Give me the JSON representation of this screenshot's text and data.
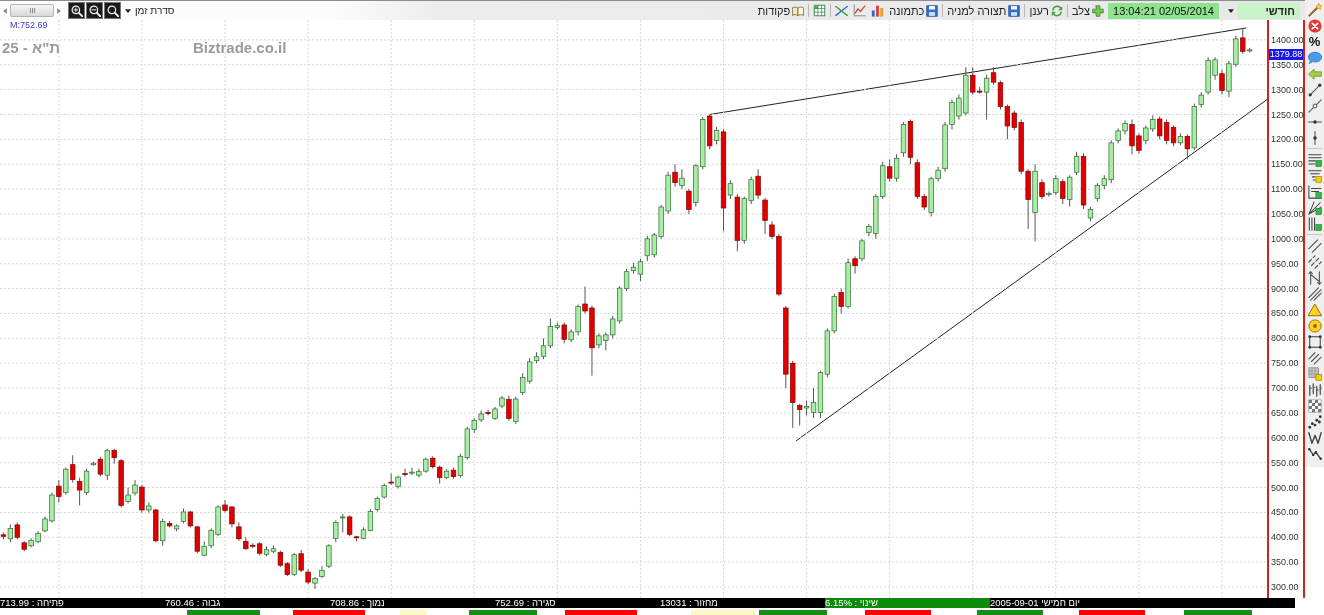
{
  "toolbar": {
    "period_dropdown": {
      "value": "חודשי"
    },
    "datetime": "13:04:21 02/05/2014",
    "buttons": [
      {
        "label": "צלב"
      },
      {
        "label": "רענן"
      },
      {
        "label": "תצורה למניה"
      },
      {
        "label": "כתמונה"
      },
      {
        "label": "פקודות"
      }
    ],
    "time_series_dropdown": {
      "label": "סדרת זמן"
    }
  },
  "drawing_tools": {
    "percent_label": "%"
  },
  "chart": {
    "marker_reading": "M:752.69",
    "instrument_label": "ת\"א - 25",
    "brand_label": "Biztrade.co.il",
    "last_price": "1379.88",
    "chart_data": {
      "type": "candlestick",
      "categories": [
        null,
        null,
        null,
        null,
        null,
        null,
        null,
        null,
        null,
        null,
        null,
        null,
        null,
        null,
        null,
        null,
        null,
        null,
        null,
        null,
        null,
        null,
        null,
        null,
        null,
        null,
        null,
        null,
        null,
        null,
        null,
        null,
        null,
        null,
        null,
        null,
        null,
        null,
        null,
        null,
        null,
        null,
        null,
        null,
        null,
        null,
        null,
        null,
        null,
        null,
        null,
        null,
        null,
        null,
        null,
        null,
        null,
        null,
        null,
        null,
        null,
        null,
        null,
        null,
        null,
        null,
        null,
        null,
        null,
        null,
        null,
        null,
        null,
        null,
        null,
        null,
        null,
        null,
        null,
        null,
        null,
        null,
        null,
        null,
        null,
        null,
        null,
        null,
        null,
        null,
        null,
        null,
        null,
        null,
        null,
        null,
        null,
        null,
        null,
        null,
        null,
        null,
        null,
        null,
        null,
        null,
        null,
        null,
        null,
        null,
        null,
        null,
        null,
        null,
        null,
        null,
        null,
        null,
        null,
        null,
        null,
        null,
        null,
        null,
        null,
        null,
        null,
        null,
        null,
        null,
        null,
        null,
        null,
        null,
        null,
        null,
        null,
        null,
        null,
        null,
        null,
        null,
        null,
        null,
        null,
        null,
        null,
        null,
        null,
        null,
        null,
        null,
        null,
        null,
        null,
        null,
        null,
        null,
        null,
        null,
        null,
        null,
        null,
        null,
        null,
        null,
        null,
        null,
        null,
        null,
        null,
        null,
        null,
        null,
        null,
        null,
        null,
        null,
        null,
        null,
        null,
        null,
        null
      ],
      "ohlc": [
        [
          405,
          410,
          396,
          402
        ],
        [
          397,
          426,
          390,
          418
        ],
        [
          425,
          430,
          396,
          400
        ],
        [
          389,
          392,
          372,
          376
        ],
        [
          383,
          398,
          380,
          394
        ],
        [
          391,
          412,
          388,
          408
        ],
        [
          413,
          442,
          410,
          437
        ],
        [
          433,
          490,
          430,
          485
        ],
        [
          503,
          515,
          470,
          482
        ],
        [
          490,
          540,
          486,
          537
        ],
        [
          546,
          565,
          510,
          516
        ],
        [
          512,
          520,
          464,
          495
        ],
        [
          490,
          538,
          485,
          533
        ],
        [
          546,
          552,
          544,
          549
        ],
        [
          557,
          562,
          522,
          527
        ],
        [
          525,
          578,
          515,
          575
        ],
        [
          575,
          578,
          548,
          560
        ],
        [
          554,
          557,
          460,
          464
        ],
        [
          472,
          500,
          468,
          485
        ],
        [
          489,
          515,
          484,
          505
        ],
        [
          501,
          505,
          450,
          455
        ],
        [
          455,
          470,
          450,
          463
        ],
        [
          455,
          457,
          390,
          393
        ],
        [
          393,
          437,
          383,
          432
        ],
        [
          428,
          433,
          420,
          423
        ],
        [
          417,
          426,
          412,
          423
        ],
        [
          432,
          458,
          428,
          451
        ],
        [
          451,
          453,
          420,
          423
        ],
        [
          421,
          423,
          368,
          372
        ],
        [
          364,
          392,
          362,
          382
        ],
        [
          383,
          418,
          378,
          414
        ],
        [
          406,
          464,
          402,
          461
        ],
        [
          465,
          475,
          450,
          454
        ],
        [
          461,
          463,
          420,
          427
        ],
        [
          421,
          430,
          393,
          397
        ],
        [
          392,
          400,
          375,
          377
        ],
        [
          384,
          388,
          378,
          382
        ],
        [
          387,
          390,
          364,
          368
        ],
        [
          366,
          382,
          362,
          375
        ],
        [
          372,
          384,
          368,
          377
        ],
        [
          370,
          373,
          340,
          344
        ],
        [
          347,
          350,
          322,
          325
        ],
        [
          325,
          368,
          322,
          365
        ],
        [
          367,
          375,
          330,
          334
        ],
        [
          330,
          336,
          306,
          310
        ],
        [
          308,
          320,
          296,
          317
        ],
        [
          321,
          342,
          318,
          333
        ],
        [
          342,
          386,
          338,
          383
        ],
        [
          398,
          434,
          390,
          430
        ],
        [
          439,
          447,
          410,
          441
        ],
        [
          441,
          444,
          402,
          406
        ],
        [
          401,
          403,
          392,
          399
        ],
        [
          398,
          420,
          396,
          415
        ],
        [
          414,
          457,
          412,
          452
        ],
        [
          456,
          482,
          452,
          478
        ],
        [
          481,
          508,
          478,
          504
        ],
        [
          511,
          528,
          506,
          509
        ],
        [
          502,
          524,
          498,
          521
        ],
        [
          528,
          538,
          522,
          526
        ],
        [
          529,
          540,
          525,
          531
        ],
        [
          525,
          538,
          520,
          532
        ],
        [
          533,
          560,
          530,
          557
        ],
        [
          559,
          563,
          538,
          542
        ],
        [
          541,
          544,
          508,
          520
        ],
        [
          520,
          537,
          517,
          533
        ],
        [
          535,
          540,
          518,
          522
        ],
        [
          524,
          568,
          520,
          563
        ],
        [
          560,
          622,
          556,
          618
        ],
        [
          617,
          640,
          610,
          635
        ],
        [
          636,
          655,
          632,
          648
        ],
        [
          651,
          656,
          645,
          649
        ],
        [
          639,
          662,
          636,
          658
        ],
        [
          664,
          684,
          660,
          680
        ],
        [
          677,
          685,
          634,
          639
        ],
        [
          633,
          683,
          628,
          678
        ],
        [
          691,
          730,
          686,
          721
        ],
        [
          713.99,
          760.46,
          708.86,
          752.69
        ],
        [
          755,
          772,
          750,
          763
        ],
        [
          764,
          800,
          758,
          785
        ],
        [
          785,
          840,
          780,
          824
        ],
        [
          822,
          832,
          818,
          826
        ],
        [
          827,
          832,
          790,
          798
        ],
        [
          797,
          818,
          792,
          813
        ],
        [
          813,
          868,
          806,
          864
        ],
        [
          869,
          904,
          850,
          855
        ],
        [
          861,
          866,
          725,
          781
        ],
        [
          787,
          810,
          780,
          805
        ],
        [
          796,
          812,
          776,
          807
        ],
        [
          807,
          845,
          800,
          839
        ],
        [
          835,
          905,
          830,
          901
        ],
        [
          900,
          940,
          895,
          934
        ],
        [
          936,
          952,
          930,
          943
        ],
        [
          929,
          960,
          915,
          954
        ],
        [
          966,
          1006,
          955,
          1000
        ],
        [
          968,
          1012,
          962,
          1008
        ],
        [
          1005,
          1068,
          1000,
          1064
        ],
        [
          1056,
          1135,
          1050,
          1128
        ],
        [
          1134,
          1150,
          1105,
          1113
        ],
        [
          1107,
          1140,
          1100,
          1122
        ],
        [
          1096,
          1100,
          1050,
          1059
        ],
        [
          1073,
          1150,
          1065,
          1147
        ],
        [
          1145,
          1245,
          1140,
          1240
        ],
        [
          1247,
          1250,
          1180,
          1187
        ],
        [
          1198,
          1225,
          1190,
          1218
        ],
        [
          1215,
          1220,
          1015,
          1062
        ],
        [
          1088,
          1118,
          1080,
          1111
        ],
        [
          1084,
          1090,
          975,
          997
        ],
        [
          997,
          1085,
          990,
          1081
        ],
        [
          1077,
          1125,
          1070,
          1119
        ],
        [
          1126,
          1140,
          1080,
          1088
        ],
        [
          1078,
          1082,
          1010,
          1037
        ],
        [
          1028,
          1035,
          1000,
          1005
        ],
        [
          1005,
          1010,
          885,
          889
        ],
        [
          861,
          865,
          700,
          728
        ],
        [
          750,
          755,
          620,
          671
        ],
        [
          665,
          668,
          625,
          657
        ],
        [
          660,
          675,
          645,
          663
        ],
        [
          651,
          700,
          640,
          671
        ],
        [
          651,
          735,
          640,
          731
        ],
        [
          728,
          820,
          722,
          815
        ],
        [
          815,
          890,
          810,
          884
        ],
        [
          892,
          900,
          850,
          864
        ],
        [
          864,
          960,
          860,
          952
        ],
        [
          960,
          965,
          930,
          946
        ],
        [
          960,
          1000,
          955,
          996
        ],
        [
          1013,
          1030,
          1005,
          1025
        ],
        [
          1011,
          1090,
          1000,
          1085
        ],
        [
          1085,
          1155,
          1080,
          1147
        ],
        [
          1145,
          1160,
          1115,
          1122
        ],
        [
          1122,
          1170,
          1115,
          1162
        ],
        [
          1173,
          1235,
          1165,
          1230
        ],
        [
          1236,
          1240,
          1150,
          1164
        ],
        [
          1153,
          1160,
          1080,
          1085
        ],
        [
          1085,
          1090,
          1058,
          1064
        ],
        [
          1053,
          1125,
          1045,
          1121
        ],
        [
          1121,
          1145,
          1115,
          1138
        ],
        [
          1141,
          1235,
          1135,
          1229
        ],
        [
          1230,
          1280,
          1220,
          1274
        ],
        [
          1247,
          1290,
          1240,
          1283
        ],
        [
          1253,
          1345,
          1248,
          1329
        ],
        [
          1329,
          1345,
          1290,
          1295
        ],
        [
          1297,
          1305,
          1292,
          1295
        ],
        [
          1295,
          1330,
          1240,
          1323
        ],
        [
          1334,
          1345,
          1310,
          1315
        ],
        [
          1314,
          1318,
          1260,
          1266
        ],
        [
          1266,
          1270,
          1200,
          1227
        ],
        [
          1253,
          1258,
          1218,
          1224
        ],
        [
          1234,
          1240,
          1130,
          1136
        ],
        [
          1136,
          1140,
          1020,
          1079
        ],
        [
          1053,
          1150,
          995,
          1136
        ],
        [
          1113,
          1120,
          1080,
          1085
        ],
        [
          1090,
          1095,
          1085,
          1091
        ],
        [
          1093,
          1128,
          1088,
          1121
        ],
        [
          1115,
          1120,
          1070,
          1081
        ],
        [
          1079,
          1128,
          1065,
          1124
        ],
        [
          1134,
          1175,
          1128,
          1166
        ],
        [
          1166,
          1172,
          1060,
          1068
        ],
        [
          1042,
          1064,
          1035,
          1059
        ],
        [
          1081,
          1112,
          1075,
          1107
        ],
        [
          1107,
          1128,
          1100,
          1121
        ],
        [
          1119,
          1198,
          1112,
          1193
        ],
        [
          1198,
          1222,
          1192,
          1217
        ],
        [
          1217,
          1238,
          1210,
          1232
        ],
        [
          1230,
          1240,
          1170,
          1187
        ],
        [
          1207,
          1212,
          1172,
          1178
        ],
        [
          1198,
          1228,
          1190,
          1223
        ],
        [
          1221,
          1248,
          1215,
          1240
        ],
        [
          1241,
          1246,
          1200,
          1207
        ],
        [
          1234,
          1240,
          1190,
          1198
        ],
        [
          1224,
          1228,
          1186,
          1193
        ],
        [
          1193,
          1212,
          1188,
          1206
        ],
        [
          1206,
          1210,
          1160,
          1181
        ],
        [
          1183,
          1272,
          1178,
          1266
        ],
        [
          1270,
          1295,
          1264,
          1289
        ],
        [
          1295,
          1365,
          1290,
          1359
        ],
        [
          1329,
          1365,
          1320,
          1360
        ],
        [
          1332,
          1340,
          1290,
          1298
        ],
        [
          1297,
          1358,
          1285,
          1352
        ],
        [
          1351,
          1408,
          1346,
          1402
        ],
        [
          1404,
          1424,
          1372,
          1377
        ],
        [
          1378,
          1384,
          1375,
          1379.88
        ],
        null,
        null
      ],
      "ylim": [
        278,
        1440
      ],
      "grid": true,
      "yticks": [
        {
          "value": 1400,
          "label": "1400.00"
        },
        {
          "value": 1350,
          "label": "1350.00"
        },
        {
          "value": 1300,
          "label": "1300.00"
        },
        {
          "value": 1250,
          "label": "1250.00"
        },
        {
          "value": 1200,
          "label": "1200.00"
        },
        {
          "value": 1150,
          "label": "1150.00"
        },
        {
          "value": 1100,
          "label": "1100.00"
        },
        {
          "value": 1050,
          "label": "1050.00"
        },
        {
          "value": 1000,
          "label": "1000.00"
        },
        {
          "value": 950,
          "label": "950.00"
        },
        {
          "value": 900,
          "label": "900.00"
        },
        {
          "value": 850,
          "label": "850.00"
        },
        {
          "value": 800,
          "label": "800.00"
        },
        {
          "value": 750,
          "label": "750.00"
        },
        {
          "value": 700,
          "label": "700.00"
        },
        {
          "value": 650,
          "label": "650.00"
        },
        {
          "value": 600,
          "label": "600.00"
        },
        {
          "value": 550,
          "label": "550.00"
        },
        {
          "value": 500,
          "label": "500.00"
        },
        {
          "value": 450,
          "label": "450.00"
        },
        {
          "value": 400,
          "label": "400.00"
        },
        {
          "value": 350,
          "label": "350.00"
        },
        {
          "value": 300,
          "label": "300.00"
        }
      ]
    }
  },
  "status_bar": [
    {
      "text": "יום חמישי 2005-09-01",
      "highlighted": false
    },
    {
      "text": "שינוי : 6.15%",
      "highlighted": true
    },
    {
      "text": "מחזור : 13031",
      "highlighted": false
    },
    {
      "text": "סגירה : 752.69",
      "highlighted": false
    },
    {
      "text": "נמוך : 708.86",
      "highlighted": false
    },
    {
      "text": "גבוה : 760.46",
      "highlighted": false
    },
    {
      "text": "פתיחה : 713.99",
      "highlighted": false
    }
  ],
  "indicator_strip": [
    {
      "color": "#139013"
    },
    {
      "color": "#ff0000"
    },
    {
      "color": "#139013"
    },
    {
      "color": "#ff0000"
    },
    {
      "color": "#139013"
    },
    {
      "color": "#fbf8c4"
    },
    {
      "color": "#ff0000"
    },
    {
      "color": "#139013"
    },
    {
      "color": "#fbf8c4"
    },
    {
      "color": "#ff0000"
    },
    {
      "color": "#139013"
    }
  ]
}
